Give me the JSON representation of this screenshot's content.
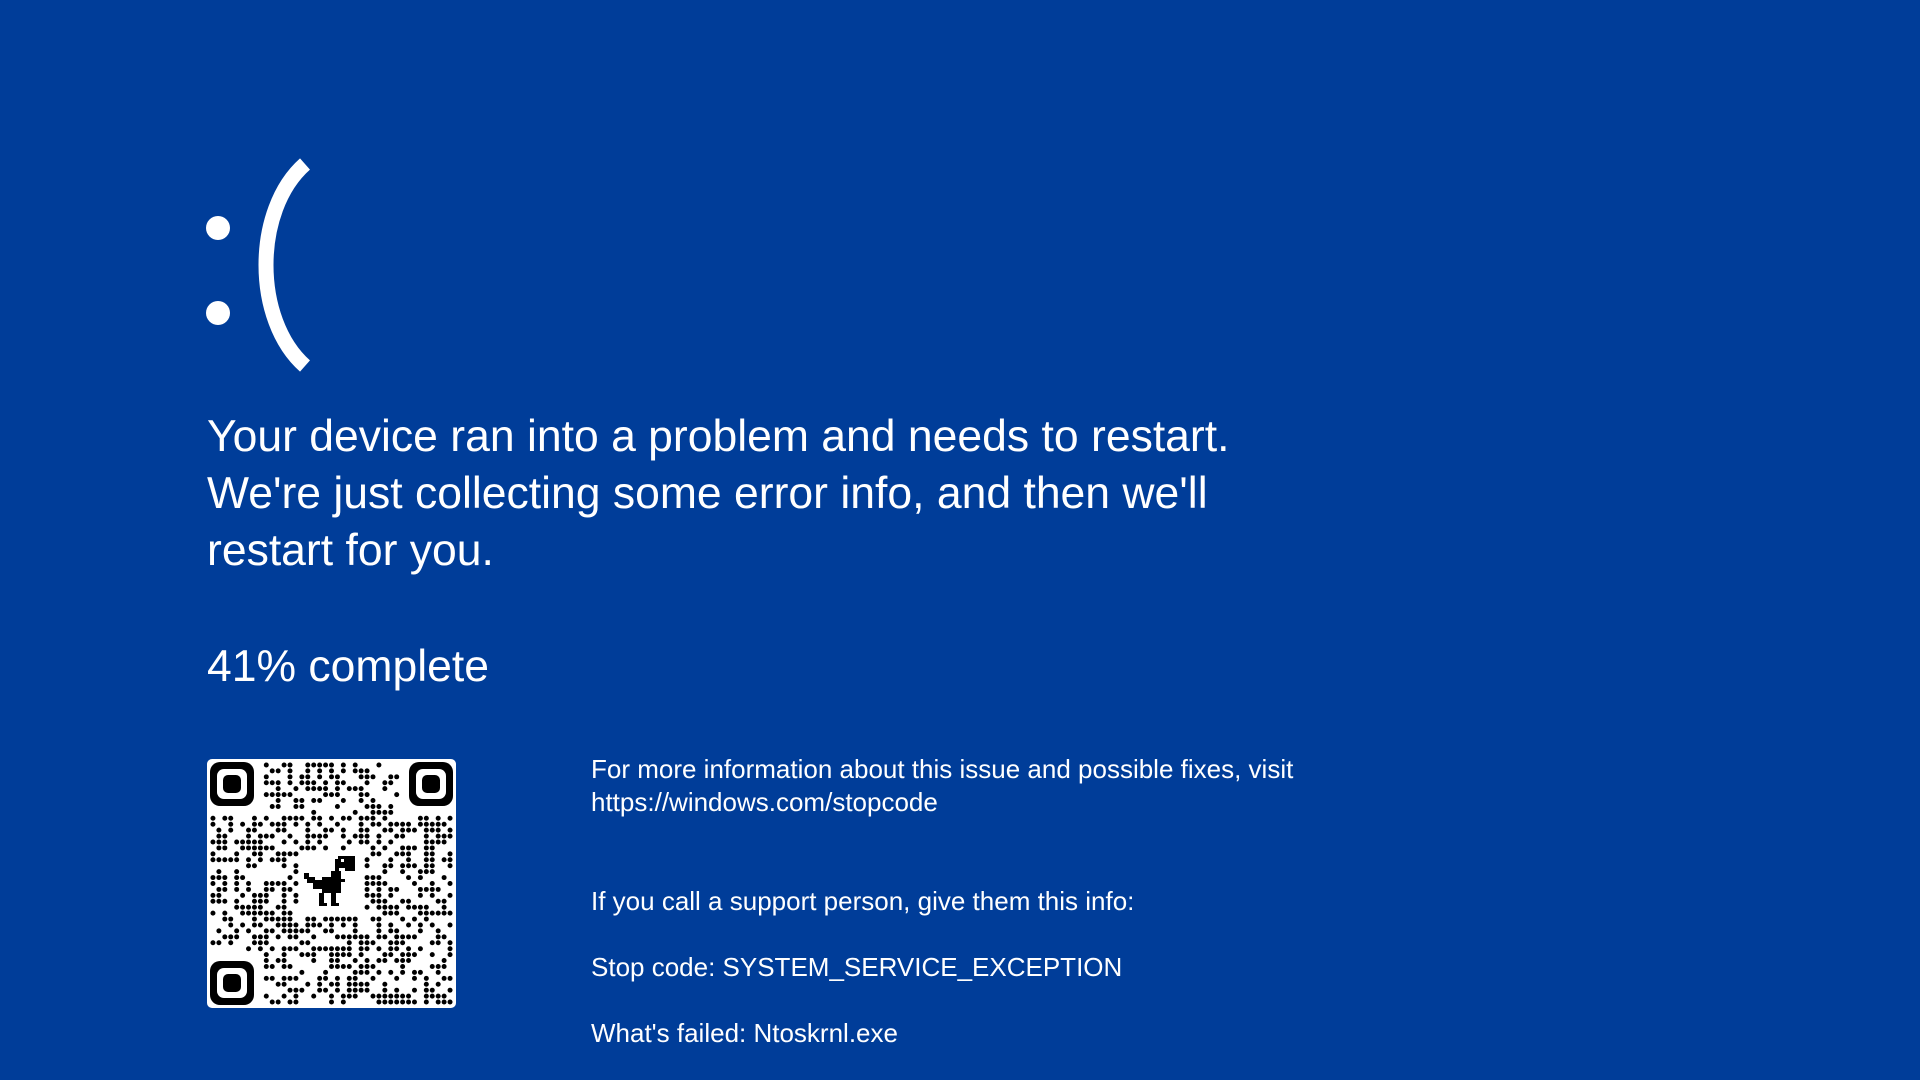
{
  "screen": {
    "background_color": "#003d99",
    "text_color": "#ffffff"
  },
  "sad_face": {
    "icon": "sad-face-icon"
  },
  "message": {
    "line1": "Your device ran into a problem and needs to restart.",
    "line2": "We're just collecting some error info, and then we'll",
    "line3": "restart for you."
  },
  "progress": {
    "value_percent": 41,
    "text": "41% complete"
  },
  "qr_code": {
    "icon": "qr-code-icon",
    "center_icon": "dinosaur-icon"
  },
  "info": {
    "more_info_line1": "For more information about this issue and possible fixes, visit",
    "more_info_line2": "https://windows.com/stopcode",
    "support": "If you call a support person, give them this info:",
    "stop_code": "Stop code: SYSTEM_SERVICE_EXCEPTION",
    "failed": "What's failed: Ntoskrnl.exe"
  }
}
